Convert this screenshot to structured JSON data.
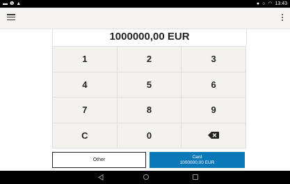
{
  "status_bar": {
    "time": "13:43",
    "left_icons": [
      "message-icon",
      "warning-icon",
      "alert-icon"
    ],
    "right_icons": [
      "location-icon",
      "vpn-key-icon",
      "wifi-icon"
    ]
  },
  "app_bar": {
    "menu_icon": "hamburger-menu-icon",
    "overflow_icon": "more-vert-icon"
  },
  "amount_display": "1000000,00 EUR",
  "keypad": {
    "keys": [
      "1",
      "2",
      "3",
      "4",
      "5",
      "6",
      "7",
      "8",
      "9",
      "C",
      "0"
    ],
    "backspace_icon": "backspace-icon"
  },
  "actions": {
    "other_label": "Other",
    "card_label": "Card",
    "card_amount": "1000000,00 EUR"
  },
  "nav_bar": {
    "icons": [
      "back-icon",
      "home-icon",
      "recents-icon"
    ]
  },
  "colors": {
    "primary": "#0b78b8",
    "keypad_bg": "#f4f2ef",
    "appbar_bg": "#f6f4f2",
    "system_bar": "#000000"
  }
}
